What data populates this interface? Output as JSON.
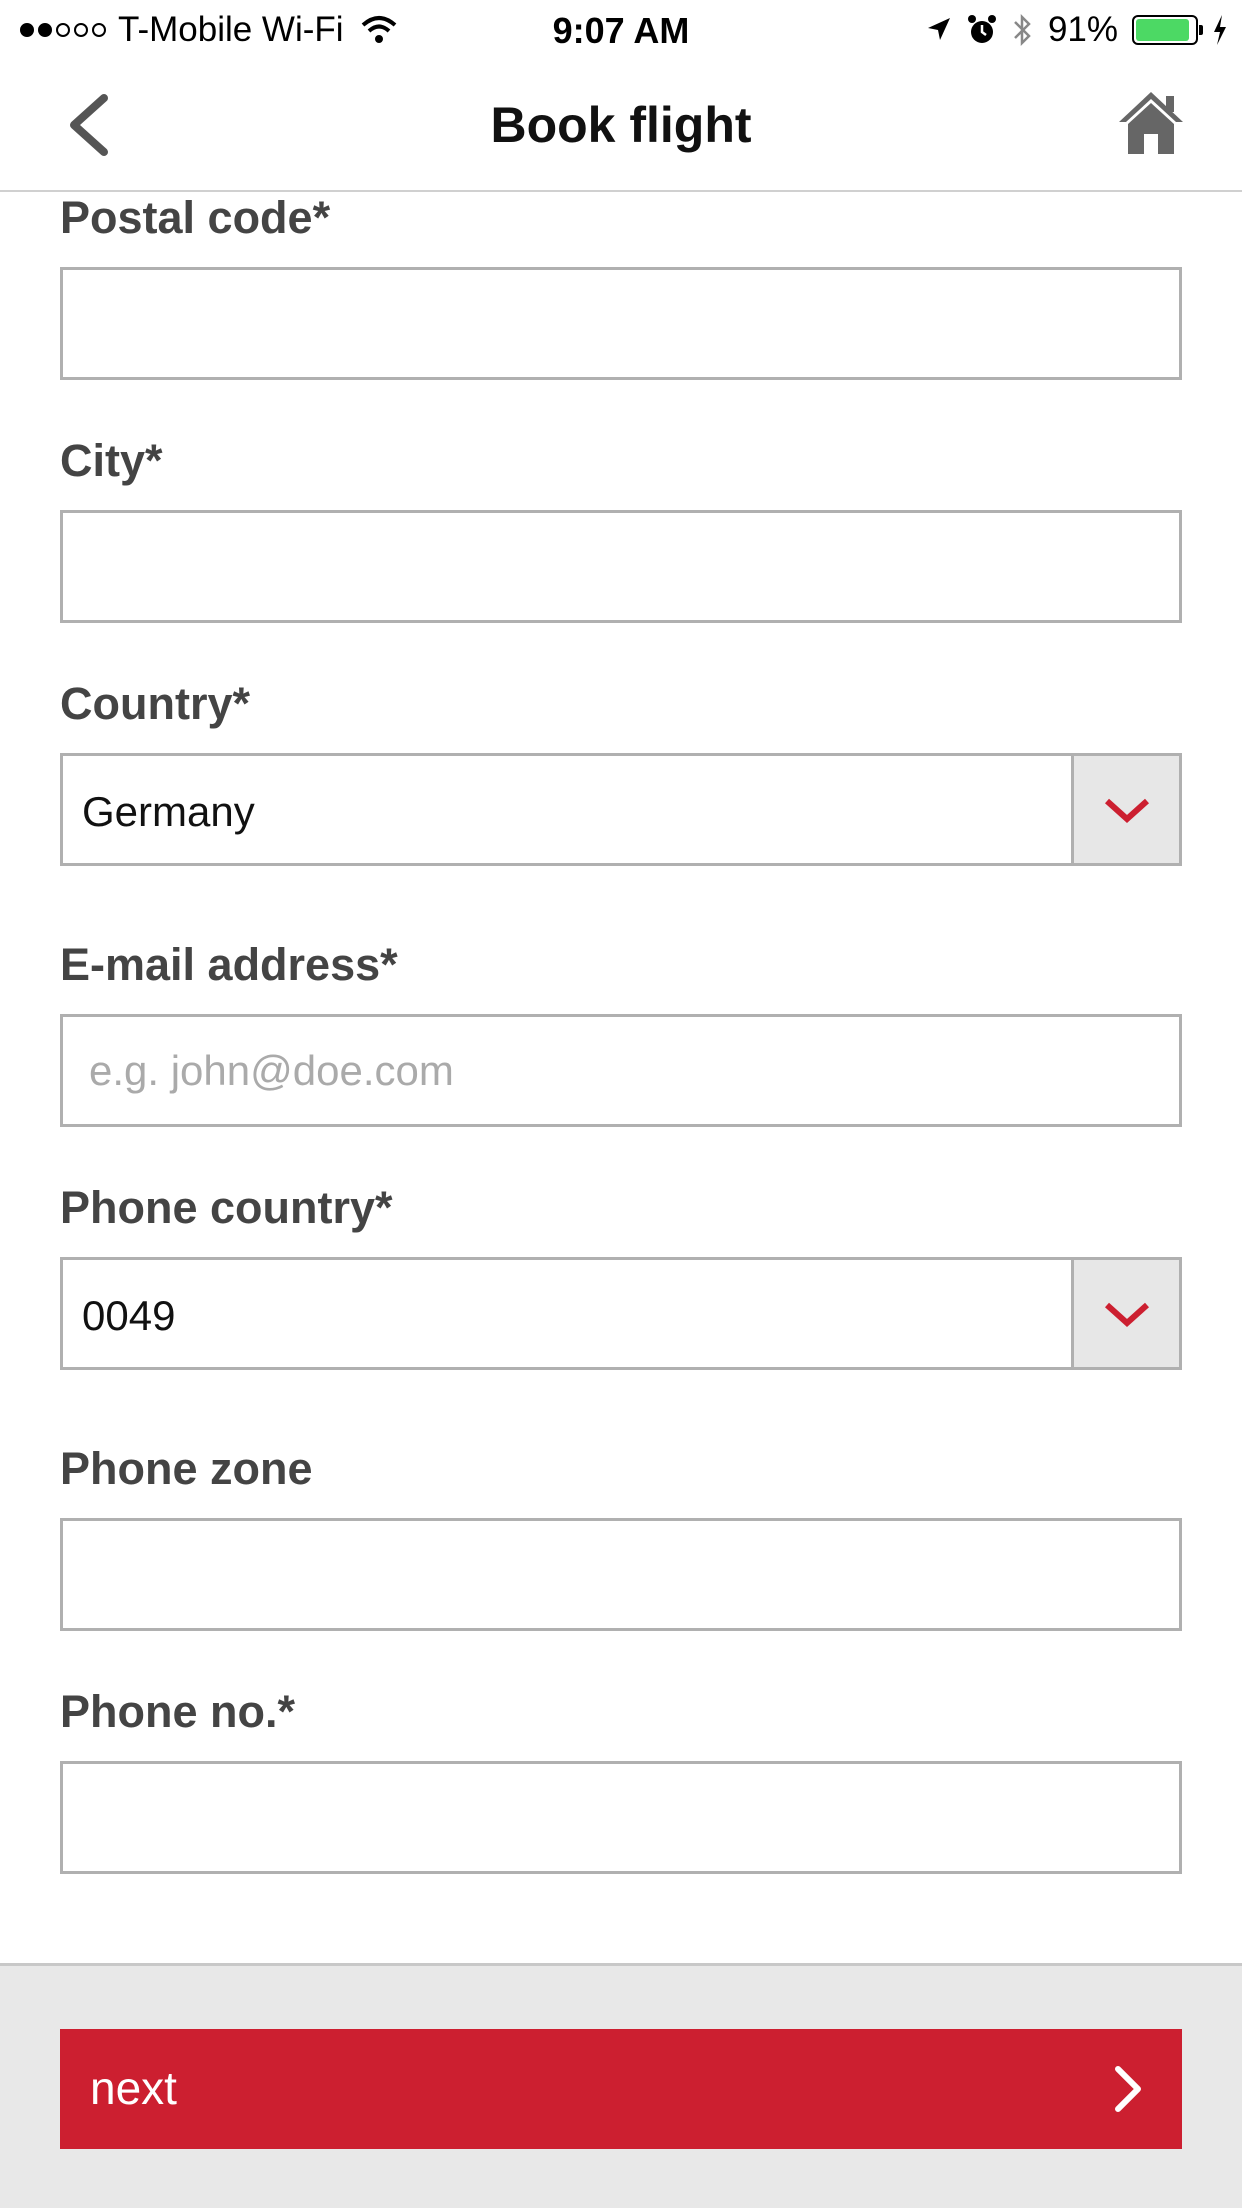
{
  "status_bar": {
    "signal_icon": "signal-dots-icon",
    "carrier": "T-Mobile Wi-Fi",
    "time": "9:07 AM",
    "battery_percent": "91%",
    "battery_level": 0.91,
    "battery_color": "#4cd964"
  },
  "nav": {
    "title": "Book flight",
    "back_icon": "chevron-left-icon",
    "home_icon": "home-icon"
  },
  "form": {
    "postal_code": {
      "label": "Postal code*",
      "value": "",
      "placeholder": ""
    },
    "city": {
      "label": "City*",
      "value": "",
      "placeholder": ""
    },
    "country": {
      "label": "Country*",
      "value": "Germany"
    },
    "email": {
      "label": "E-mail address*",
      "value": "",
      "placeholder": "e.g. john@doe.com"
    },
    "phone_country": {
      "label": "Phone country*",
      "value": "0049"
    },
    "phone_zone": {
      "label": "Phone zone",
      "value": "",
      "placeholder": ""
    },
    "phone_no": {
      "label": "Phone no.*",
      "value": "",
      "placeholder": ""
    }
  },
  "footer": {
    "next_label": "next",
    "accent_color": "#cc1f30"
  }
}
